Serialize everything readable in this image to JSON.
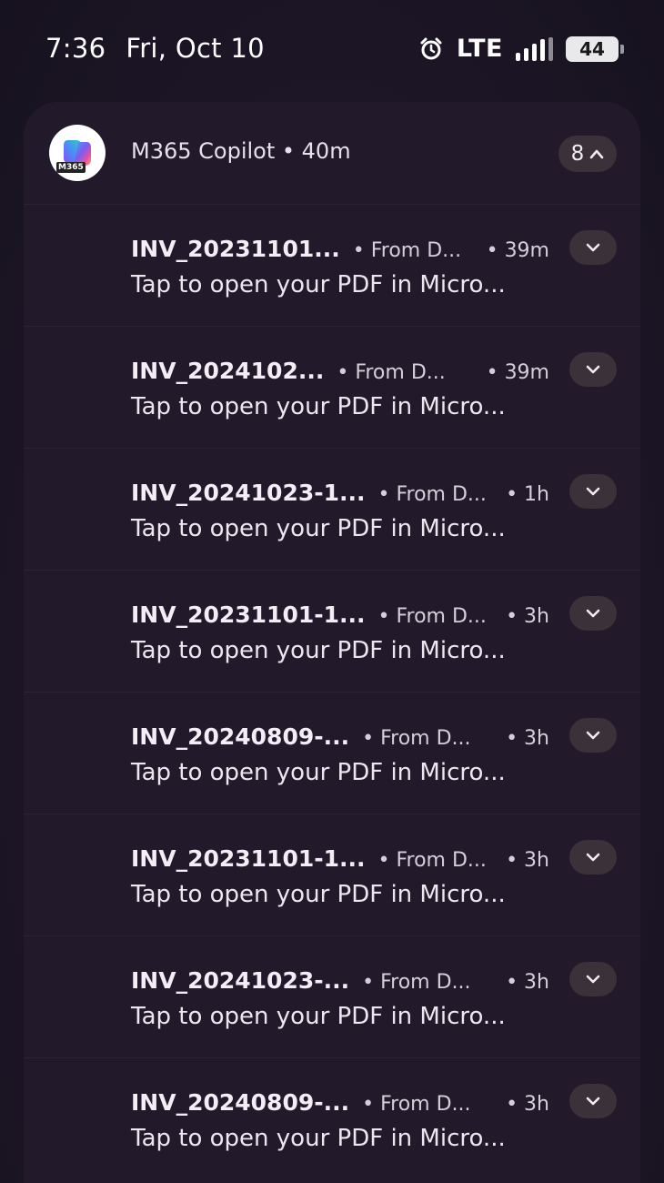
{
  "status_bar": {
    "time": "7:36",
    "date": "Fri, Oct 10",
    "network": "LTE",
    "battery": "44",
    "icons": [
      "alarm-icon",
      "signal-icon",
      "battery-icon"
    ]
  },
  "group": {
    "app_icon_label": "M365",
    "title": "M365 Copilot • 40m",
    "count": "8",
    "collapse_icon": "chevron-up-icon"
  },
  "notifications": [
    {
      "title": "INV_20231101...",
      "meta": "• From D...",
      "time": "• 39m",
      "body": "Tap to open your PDF in Micro..."
    },
    {
      "title": "INV_2024102...",
      "meta": "• From D...",
      "time": "• 39m",
      "body": "Tap to open your PDF in Micro..."
    },
    {
      "title": "INV_20241023-1...",
      "meta": "• From D...",
      "time": "• 1h",
      "body": "Tap to open your PDF in Micro..."
    },
    {
      "title": "INV_20231101-1...",
      "meta": "• From D...",
      "time": "• 3h",
      "body": "Tap to open your PDF in Micro..."
    },
    {
      "title": "INV_20240809-...",
      "meta": "• From D...",
      "time": "• 3h",
      "body": "Tap to open your PDF in Micro..."
    },
    {
      "title": "INV_20231101-1...",
      "meta": "• From D...",
      "time": "• 3h",
      "body": "Tap to open your PDF in Micro..."
    },
    {
      "title": "INV_20241023-...",
      "meta": "• From D...",
      "time": "• 3h",
      "body": "Tap to open your PDF in Micro..."
    },
    {
      "title": "INV_20240809-...",
      "meta": "• From D...",
      "time": "• 3h",
      "body": "Tap to open your PDF in Micro..."
    }
  ]
}
